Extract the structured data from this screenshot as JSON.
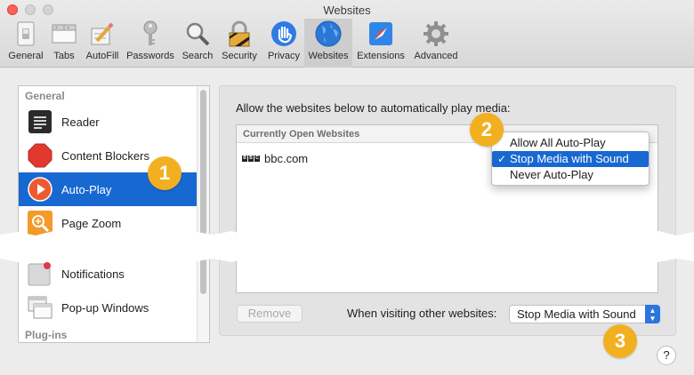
{
  "window": {
    "title": "Websites"
  },
  "toolbar": {
    "items": [
      {
        "label": "General",
        "icon": "general-switch-icon"
      },
      {
        "label": "Tabs",
        "icon": "tabs-icon"
      },
      {
        "label": "AutoFill",
        "icon": "pencil-form-icon"
      },
      {
        "label": "Passwords",
        "icon": "key-icon"
      },
      {
        "label": "Search",
        "icon": "magnifier-icon"
      },
      {
        "label": "Security",
        "icon": "padlock-icon"
      },
      {
        "label": "Privacy",
        "icon": "hand-icon"
      },
      {
        "label": "Websites",
        "icon": "globe-icon"
      },
      {
        "label": "Extensions",
        "icon": "puzzle-compass-icon"
      },
      {
        "label": "Advanced",
        "icon": "gear-icon"
      }
    ],
    "active": "Websites"
  },
  "sidebar": {
    "section_general": "General",
    "items": [
      {
        "label": "Reader",
        "icon": "reader-icon"
      },
      {
        "label": "Content Blockers",
        "icon": "stop-sign-icon"
      },
      {
        "label": "Auto-Play",
        "icon": "play-icon"
      },
      {
        "label": "Page Zoom",
        "icon": "zoom-icon"
      },
      {
        "label": "Notifications",
        "icon": "notification-icon"
      },
      {
        "label": "Pop-up Windows",
        "icon": "popup-windows-icon"
      }
    ],
    "selected": "Auto-Play",
    "section_plugins": "Plug-ins"
  },
  "main": {
    "caption": "Allow the websites below to automatically play media:",
    "list_header": "Currently Open Websites",
    "sites": [
      {
        "name": "bbc.com"
      }
    ],
    "menu": {
      "options": [
        "Allow All Auto-Play",
        "Stop Media with Sound",
        "Never Auto-Play"
      ],
      "selected": "Stop Media with Sound",
      "check": "✓"
    },
    "remove_button": "Remove",
    "other_label": "When visiting other websites:",
    "other_value": "Stop Media with Sound"
  },
  "help": "?",
  "badges": [
    "1",
    "2",
    "3"
  ],
  "colors": {
    "accent": "#1868d2",
    "badge": "#f2b021"
  }
}
